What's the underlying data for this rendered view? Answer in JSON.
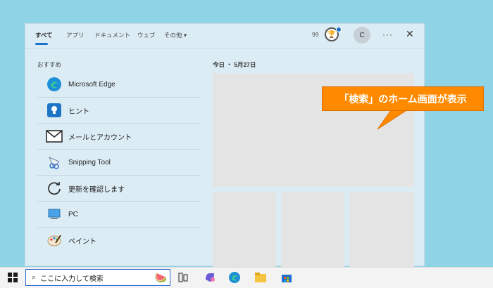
{
  "tabs": [
    "すべて",
    "アプリ",
    "ドキュメント",
    "ウェブ",
    "その他 ▾"
  ],
  "header": {
    "points": "99",
    "avatar_letter": "C",
    "more": "···",
    "close": "✕"
  },
  "recommended": {
    "title": "おすすめ",
    "items": [
      {
        "label": "Microsoft Edge",
        "icon": "edge-icon"
      },
      {
        "label": "ヒント",
        "icon": "tips-icon"
      },
      {
        "label": "メールとアカウント",
        "icon": "mail-icon"
      },
      {
        "label": "Snipping Tool",
        "icon": "snipping-tool-icon"
      },
      {
        "label": "更新を確認します",
        "icon": "refresh-icon"
      },
      {
        "label": "PC",
        "icon": "pc-icon"
      },
      {
        "label": "ペイント",
        "icon": "paint-icon"
      }
    ]
  },
  "today": {
    "title": "今日 ・ 5月27日"
  },
  "callout": {
    "text": "「検索」のホーム画面が表示"
  },
  "taskbar": {
    "search_placeholder": "ここに入力して検索"
  },
  "colors": {
    "accent": "#1a73c9",
    "callout": "#ff8a00"
  }
}
